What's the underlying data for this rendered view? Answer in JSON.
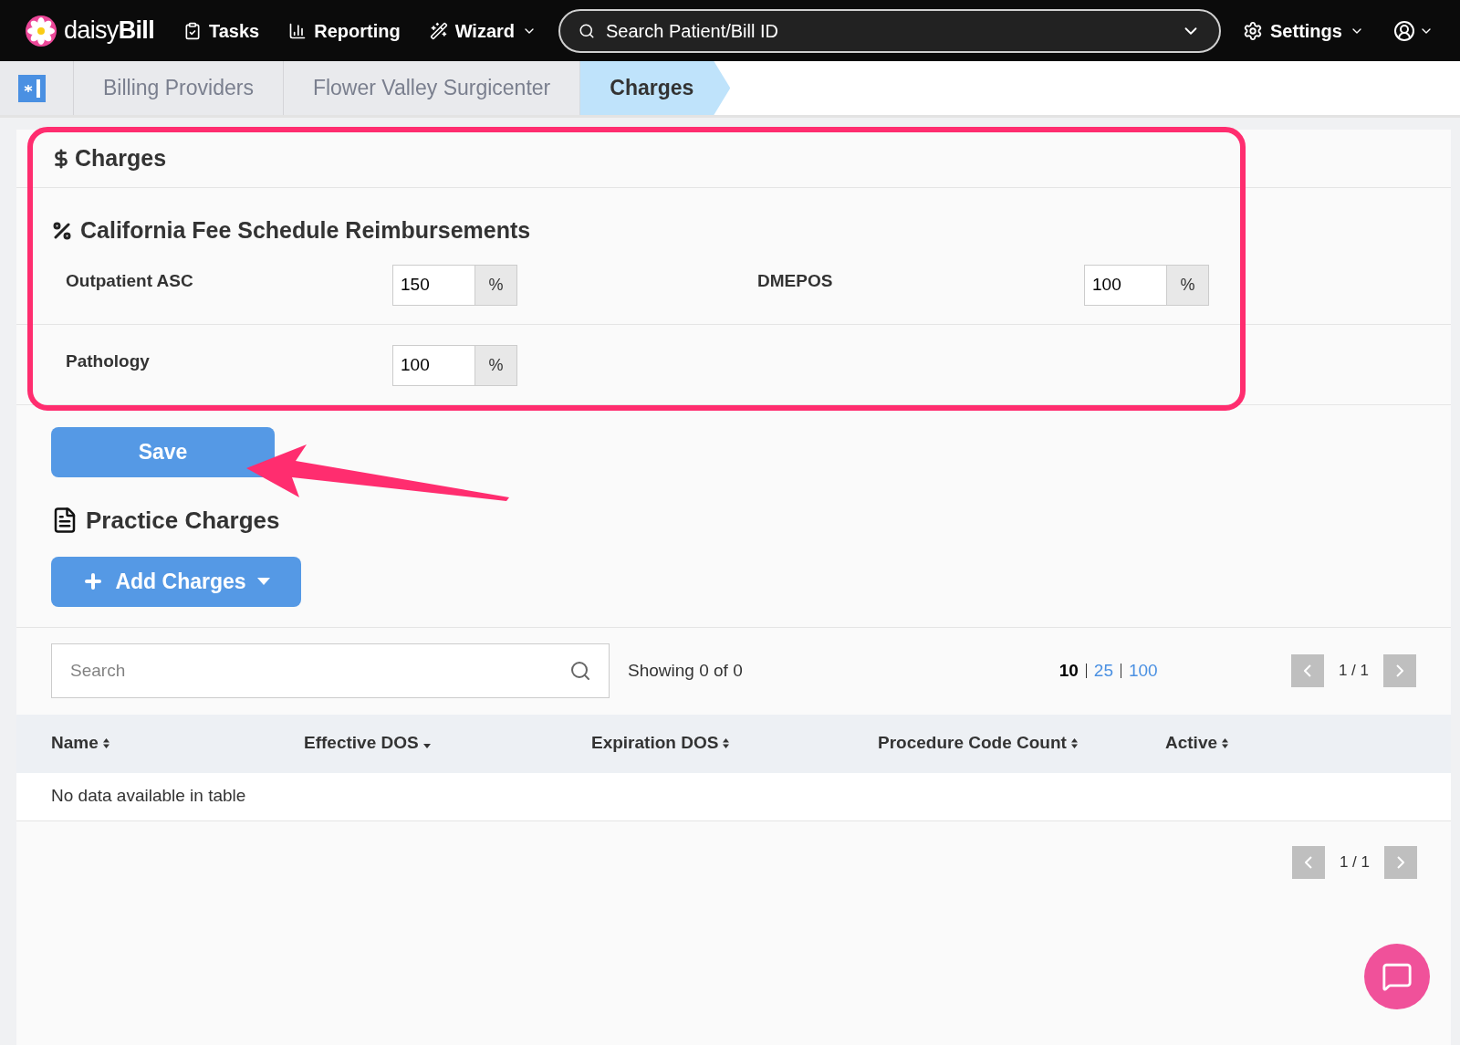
{
  "navbar": {
    "logo": {
      "prefix": "daisy",
      "suffix": "Bill"
    },
    "items": [
      {
        "label": "Tasks",
        "kind": "tasks",
        "dropdown": false
      },
      {
        "label": "Reporting",
        "kind": "reporting",
        "dropdown": false
      },
      {
        "label": "Wizard",
        "kind": "wizard",
        "dropdown": true
      }
    ],
    "search": {
      "placeholder": "Search Patient/Bill ID"
    },
    "settings": {
      "label": "Settings"
    }
  },
  "breadcrumb": [
    {
      "label": "Billing Providers",
      "selected": false
    },
    {
      "label": "Flower Valley Surgicenter",
      "selected": false
    },
    {
      "label": "Charges",
      "selected": true
    }
  ],
  "charges": {
    "title": "Charges",
    "section_title": "California Fee Schedule Reimbursements",
    "rows": [
      [
        {
          "label": "Outpatient ASC",
          "value": "150",
          "unit": "%"
        },
        {
          "label": "DMEPOS",
          "value": "100",
          "unit": "%"
        }
      ],
      [
        {
          "label": "Pathology",
          "value": "100",
          "unit": "%"
        }
      ]
    ],
    "save_button": "Save"
  },
  "practice_charges": {
    "title": "Practice Charges",
    "add_button": "Add Charges",
    "search": {
      "placeholder": "Search"
    },
    "showing": "Showing 0 of 0",
    "page_sizes": [
      {
        "label": "10",
        "selected": true
      },
      {
        "label": "25",
        "selected": false
      },
      {
        "label": "100",
        "selected": false
      }
    ],
    "page": "1 / 1",
    "columns": [
      {
        "label": "Name",
        "sorted": false
      },
      {
        "label": "Effective DOS",
        "sorted": true
      },
      {
        "label": "Expiration DOS",
        "sorted": false
      },
      {
        "label": "Procedure Code Count",
        "sorted": false
      },
      {
        "label": "Active",
        "sorted": false
      }
    ],
    "empty_message": "No data available in table",
    "bottom_page": "1 / 1"
  }
}
